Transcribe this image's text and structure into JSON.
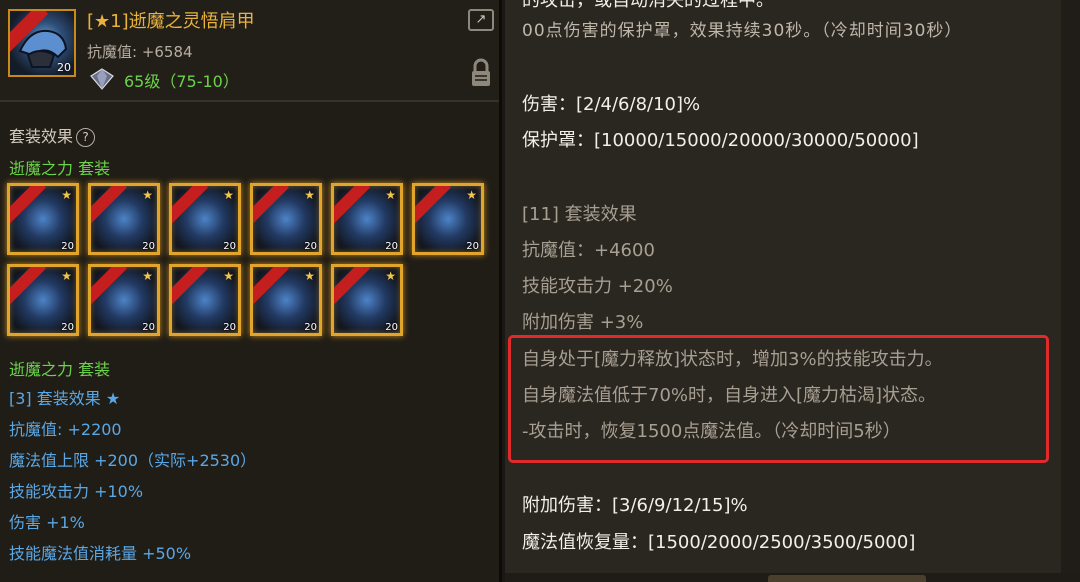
{
  "item": {
    "title": "[★1]逝魔之灵悟肩甲",
    "stat": "抗魔值: +6584",
    "level": "65级（75-10）",
    "icon_stack": "20",
    "share_icon": "share-icon",
    "lock_icon": "lock-icon",
    "gem_icon": "gem-icon"
  },
  "set": {
    "header": "套装效果",
    "help_glyph": "?",
    "name": "逝魔之力 套装",
    "slots": [
      {
        "lvl": "20"
      },
      {
        "lvl": "20"
      },
      {
        "lvl": "20"
      },
      {
        "lvl": "20"
      },
      {
        "lvl": "20"
      },
      {
        "lvl": "20"
      },
      {
        "lvl": "20"
      },
      {
        "lvl": "20"
      },
      {
        "lvl": "20"
      },
      {
        "lvl": "20"
      },
      {
        "lvl": "20"
      }
    ],
    "name_2": "逝魔之力 套装",
    "bonus_title": "[3] 套装效果 ★",
    "bonuses": [
      "抗魔值: +2200",
      "魔法值上限 +200（实际+2530）",
      "技能攻击力 +10%",
      "伤害 +1%",
      "技能魔法值消耗量 +50%"
    ]
  },
  "right": {
    "cut_top": "的攻击，或自动消失的过程中。",
    "partial_line": "00点伤害的保护罩，效果持续30秒。（冷却时间30秒）",
    "damage": "伤害：[2/4/6/8/10]%",
    "shield": "保护罩：[10000/15000/20000/30000/50000]",
    "set11_title": "[11] 套装效果",
    "set11_lines": [
      "抗魔值：+4600",
      "技能攻击力 +20%",
      "附加伤害 +3%"
    ],
    "highlight_lines": [
      "自身处于[魔力释放]状态时，增加3%的技能攻击力。",
      "自身魔法值低于70%时，自身进入[魔力枯渴]状态。",
      "-攻击时，恢复1500点魔法值。（冷却时间5秒）"
    ],
    "extra_damage": "附加伤害：[3/6/9/12/15]%",
    "mp_recover": "魔法值恢复量：[1500/2000/2500/3500/5000]"
  },
  "colors": {
    "title_gold": "#e9b23b",
    "set_green": "#6cd24b",
    "bonus_blue": "#5aa7e6",
    "highlight_red": "#e12a2a"
  }
}
